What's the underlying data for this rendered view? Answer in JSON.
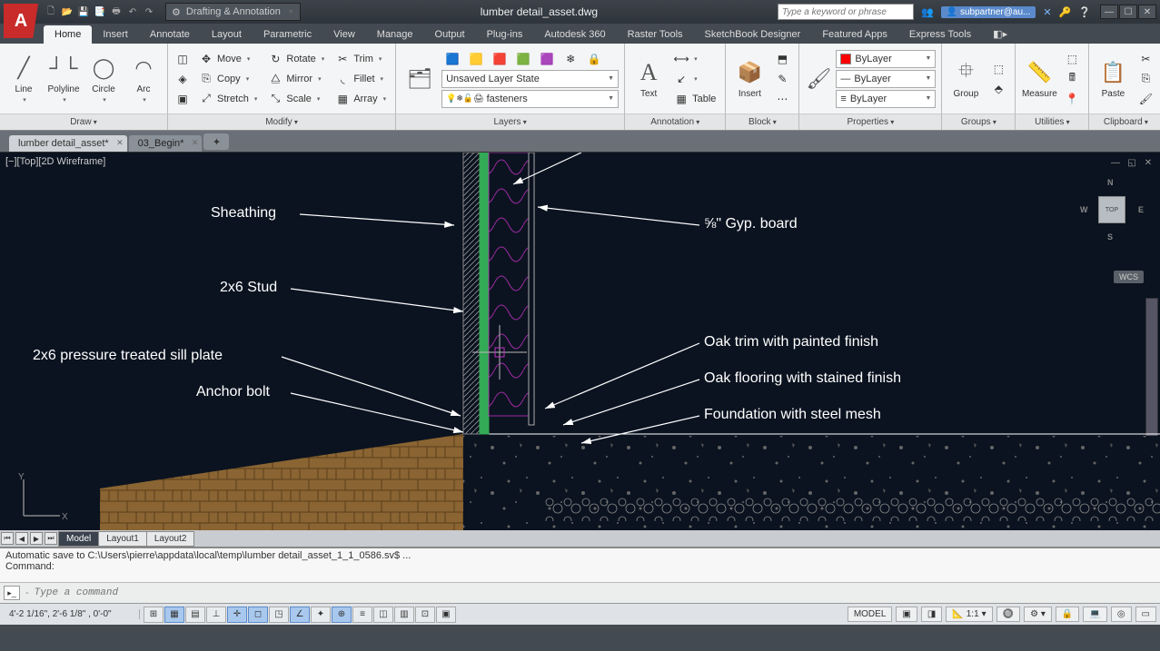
{
  "app": {
    "title": "lumber detail_asset.dwg",
    "workspace": "Drafting & Annotation",
    "search_placeholder": "Type a keyword or phrase",
    "user": "subpartner@au..."
  },
  "win": {
    "min": "—",
    "max": "☐",
    "close": "✕"
  },
  "menus": [
    "Home",
    "Insert",
    "Annotate",
    "Layout",
    "Parametric",
    "View",
    "Manage",
    "Output",
    "Plug-ins",
    "Autodesk 360",
    "Raster Tools",
    "SketchBook Designer",
    "Featured Apps",
    "Express Tools"
  ],
  "menu_active": 0,
  "ribbon": {
    "draw": {
      "title": "Draw",
      "big": [
        [
          "Line",
          "╱"
        ],
        [
          "Polyline",
          "┘└"
        ],
        [
          "Circle",
          "◯"
        ],
        [
          "Arc",
          "◠"
        ]
      ]
    },
    "modify": {
      "title": "Modify",
      "col1": [
        [
          "Move",
          "✥"
        ],
        [
          "Copy",
          "⎘"
        ],
        [
          "Stretch",
          "⤢"
        ]
      ],
      "col2": [
        [
          "Rotate",
          "↻"
        ],
        [
          "Mirror",
          "⧋"
        ],
        [
          "Scale",
          "⤡"
        ]
      ],
      "col3": [
        [
          "Trim",
          "✂"
        ],
        [
          "Fillet",
          "◟"
        ],
        [
          "Array",
          "▦"
        ]
      ]
    },
    "layers": {
      "title": "Layers",
      "state": "Unsaved Layer State",
      "current": "fasteners",
      "icons": "💡❄🔓🖨"
    },
    "annotation": {
      "title": "Annotation",
      "text": "Text",
      "table": "Table"
    },
    "block": {
      "title": "Block",
      "insert": "Insert"
    },
    "properties": {
      "title": "Properties",
      "rows": [
        [
          "■",
          "ByLayer"
        ],
        [
          "—",
          "ByLayer"
        ],
        [
          "≡",
          "ByLayer"
        ]
      ]
    },
    "groups": {
      "title": "Groups",
      "label": "Group"
    },
    "utilities": {
      "title": "Utilities",
      "label": "Measure"
    },
    "clipboard": {
      "title": "Clipboard",
      "label": "Paste"
    }
  },
  "file_tabs": [
    {
      "name": "lumber detail_asset*",
      "active": true
    },
    {
      "name": "03_Begin*",
      "active": false
    }
  ],
  "viewport": {
    "label": "[−][Top][2D Wireframe]",
    "wcs": "WCS",
    "cube": "TOP"
  },
  "annotations": {
    "sheathing": "Sheathing",
    "stud": "2x6 Stud",
    "sill": "2x6 pressure treated sill plate",
    "anchor": "Anchor bolt",
    "gyp": "⅝\" Gyp. board",
    "trim": "Oak trim with painted finish",
    "floor": "Oak flooring with stained finish",
    "foundation": "Foundation with steel mesh"
  },
  "layout_tabs": {
    "model": "Model",
    "l1": "Layout1",
    "l2": "Layout2"
  },
  "command": {
    "history": "Automatic save to C:\\Users\\pierre\\appdata\\local\\temp\\lumber detail_asset_1_1_0586.sv$ ...\nCommand:",
    "placeholder": "Type a command"
  },
  "status": {
    "coords": "4'-2 1/16\", 2'-6 1/8\" , 0'-0\"",
    "right": {
      "model": "MODEL",
      "scale": "1:1"
    }
  }
}
